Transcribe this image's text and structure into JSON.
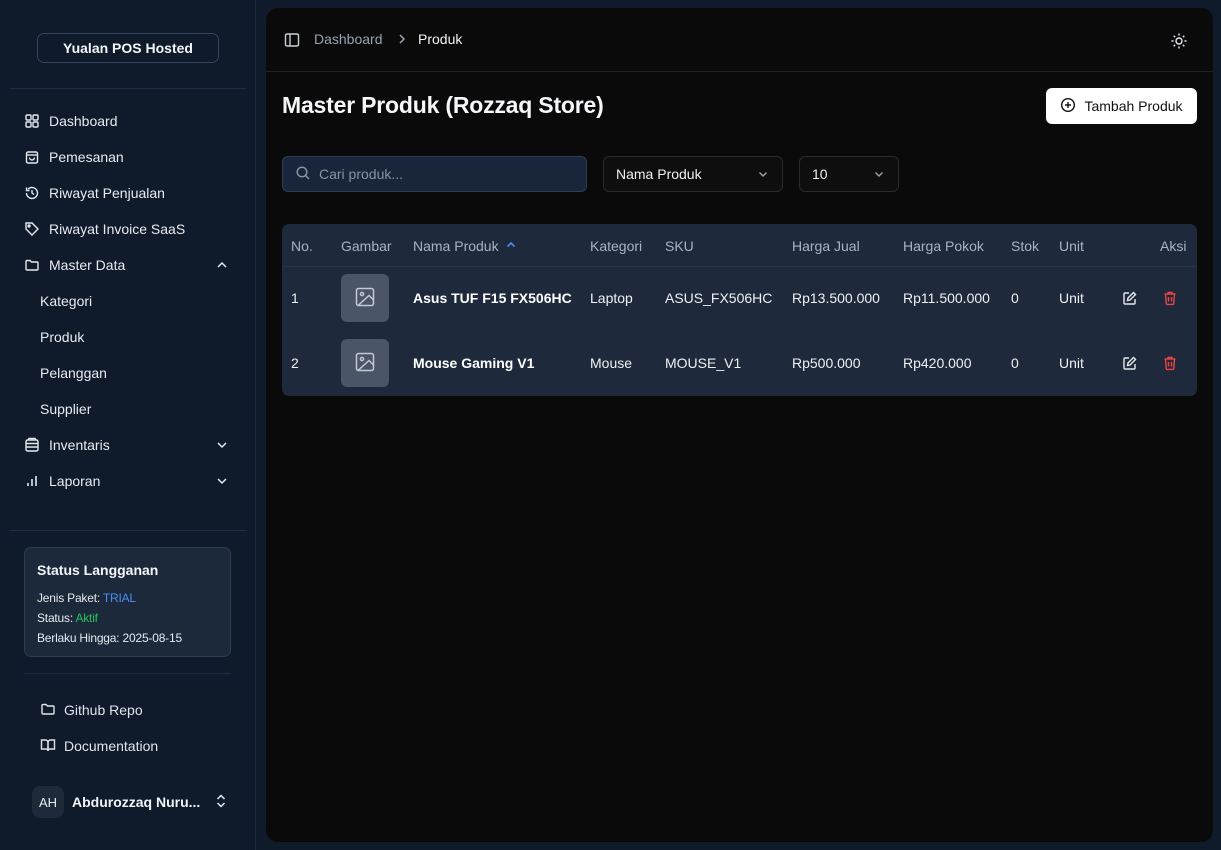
{
  "sidebar": {
    "brand": "Yualan POS Hosted",
    "nav": [
      {
        "label": "Dashboard",
        "icon": "grid-icon"
      },
      {
        "label": "Pemesanan",
        "icon": "shopping-bag-icon"
      },
      {
        "label": "Riwayat Penjualan",
        "icon": "history-icon"
      },
      {
        "label": "Riwayat Invoice SaaS",
        "icon": "tag-icon"
      },
      {
        "label": "Master Data",
        "icon": "folder-icon",
        "expanded": true
      },
      {
        "label": "Inventaris",
        "icon": "database-icon",
        "expanded": false
      },
      {
        "label": "Laporan",
        "icon": "bar-chart-icon",
        "expanded": false
      }
    ],
    "master_data_items": [
      "Kategori",
      "Produk",
      "Pelanggan",
      "Supplier"
    ],
    "status": {
      "title": "Status Langganan",
      "plan_label": "Jenis Paket:",
      "plan_value": "TRIAL",
      "status_label": "Status:",
      "status_value": "Aktif",
      "valid_label": "Berlaku Hingga:",
      "valid_value": "2025-08-15"
    },
    "footer_links": [
      "Github Repo",
      "Documentation"
    ],
    "user": {
      "initials": "AH",
      "name": "Abdurozzaq Nuru..."
    }
  },
  "header": {
    "breadcrumb": [
      "Dashboard",
      "Produk"
    ],
    "breadcrumb_sep": "›"
  },
  "main": {
    "title": "Master Produk (Rozzaq Store)",
    "add_button": "Tambah Produk",
    "search_placeholder": "Cari produk...",
    "sort_select": "Nama Produk",
    "per_page_select": "10"
  },
  "table": {
    "columns": [
      "No.",
      "Gambar",
      "Nama Produk",
      "Kategori",
      "SKU",
      "Harga Jual",
      "Harga Pokok",
      "Stok",
      "Unit",
      "Aksi"
    ],
    "rows": [
      {
        "no": "1",
        "name": "Asus TUF F15 FX506HC",
        "category": "Laptop",
        "sku": "ASUS_FX506HC",
        "price": "Rp13.500.000",
        "cost": "Rp11.500.000",
        "stock": "0",
        "unit": "Unit"
      },
      {
        "no": "2",
        "name": "Mouse Gaming V1",
        "category": "Mouse",
        "sku": "MOUSE_V1",
        "price": "Rp500.000",
        "cost": "Rp420.000",
        "stock": "0",
        "unit": "Unit"
      }
    ]
  },
  "colors": {
    "sidebar_bg": "#0f1a2b",
    "main_bg": "#0a0a0a",
    "table_bg": "#1e293b",
    "accent_blue": "#4b8ef0",
    "active_green": "#22c55e",
    "danger_red": "#ef4444"
  }
}
